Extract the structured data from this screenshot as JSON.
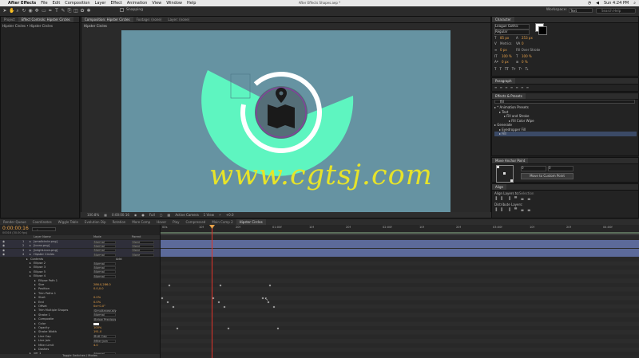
{
  "menubar": {
    "apple": "",
    "app": "After Effects",
    "items": [
      "File",
      "Edit",
      "Composition",
      "Layer",
      "Effect",
      "Animation",
      "View",
      "Window",
      "Help"
    ],
    "document_title": "After Effects Shapes.aep *",
    "clock": "Sun 4:24 PM"
  },
  "toolbar": {
    "snapping_label": "Snapping",
    "workspace_label": "Workspace:",
    "workspace_value": "Text",
    "search_placeholder": "Search Help"
  },
  "project": {
    "tabs": [
      "Project",
      "Effect Controls: Hipster Circles"
    ],
    "breadcrumb": "Hipster Circles • Hipster Circles"
  },
  "viewer": {
    "tabs": [
      "Composition: Hipster Circles",
      "Footage: (none)",
      "Layer: (none)"
    ],
    "comp_tab": "Hipster Circles",
    "zoom": "100.8%",
    "timecode": "0:00:00:16",
    "resolution": "Full",
    "camera": "Active Camera",
    "views": "1 View",
    "exposure": "+0.0"
  },
  "watermark": "www.cgtsj.com",
  "character": {
    "title": "Character",
    "font": "League Gothic",
    "style": "Regular",
    "size": "85 px",
    "leading": "253 px",
    "tracking": "Metrics",
    "kerning": "0",
    "stroke_width": "0 px",
    "stroke_mode": "Fill Over Stroke",
    "vscale": "100 %",
    "hscale": "100 %",
    "baseline": "0 px",
    "tsume": "0 %",
    "text_buttons": [
      "T",
      "T",
      "TT",
      "Tт",
      "T¹",
      "T₁"
    ]
  },
  "paragraph": {
    "title": "Paragraph"
  },
  "effects": {
    "title": "Effects & Presets",
    "search_value": "fill",
    "items": [
      {
        "label": "* Animation Presets",
        "indent": 0
      },
      {
        "label": "Text",
        "indent": 1
      },
      {
        "label": "Fill and Stroke",
        "indent": 2
      },
      {
        "label": "Fill Color Wipe",
        "indent": 3
      },
      {
        "label": "Generate",
        "indent": 0
      },
      {
        "label": "Eyedropper Fill",
        "indent": 1
      },
      {
        "label": "Fill",
        "indent": 1
      }
    ]
  },
  "anchor": {
    "title": "Move Anchor Point",
    "x": "0",
    "y": "0",
    "button": "Move to Custom Point"
  },
  "align": {
    "title": "Align",
    "align_to_label": "Align Layers to:",
    "align_to_value": "Selection",
    "distribute_label": "Distribute Layers:"
  },
  "timeline": {
    "tabs": [
      "Render Queue",
      "Coordinates",
      "Wiggle Table",
      "Evolution Dip",
      "Rotation",
      "More Comp",
      "Hover",
      "Play",
      "Compressed",
      "Main Comp 2",
      "Hipster Circles"
    ],
    "timecode": "0:00:00:16",
    "timecode_sub": "00016 (30.00 fps)",
    "col_layer_name": "Layer Name",
    "col_mode": "Mode",
    "col_parent": "Parent",
    "ruler": [
      "00s",
      "10f",
      "20f",
      "01:00f",
      "10f",
      "20f",
      "02:00f",
      "10f",
      "20f",
      "03:00f",
      "10f",
      "20f",
      "04:00f"
    ],
    "rows": [
      {
        "num": "1",
        "name": "[smallcircle.png]",
        "mode": "Normal",
        "parent": "None",
        "type": "layer"
      },
      {
        "num": "2",
        "name": "[icons.png]",
        "mode": "Normal",
        "parent": "None",
        "type": "layer"
      },
      {
        "num": "3",
        "name": "[bright-icon.png]",
        "mode": "Normal",
        "parent": "None",
        "type": "layer"
      },
      {
        "num": "4",
        "name": "Hipster Circles",
        "mode": "Normal",
        "parent": "None",
        "type": "layer"
      },
      {
        "name": "Contents",
        "type": "group",
        "extra": "Add:"
      },
      {
        "name": "Ellipse 2",
        "mode": "Normal",
        "type": "group"
      },
      {
        "name": "Ellipse 3",
        "mode": "Normal",
        "type": "group"
      },
      {
        "name": "Ellipse 5",
        "mode": "Normal",
        "type": "group"
      },
      {
        "name": "Ellipse 4",
        "mode": "Normal",
        "type": "group"
      },
      {
        "name": "Ellipse Path 1",
        "type": "prop"
      },
      {
        "name": "Size",
        "value": "286.0,286.0",
        "type": "prop"
      },
      {
        "name": "Position",
        "value": "0.0,0.0",
        "type": "prop"
      },
      {
        "name": "Trim Paths 1",
        "type": "prop"
      },
      {
        "name": "Start",
        "value": "0.0%",
        "type": "prop"
      },
      {
        "name": "End",
        "value": "0.0%",
        "type": "prop"
      },
      {
        "name": "Offset",
        "value": "0x+0.0°",
        "type": "prop"
      },
      {
        "name": "Trim Multiple Shapes",
        "mode": "Simultaneously",
        "type": "prop"
      },
      {
        "name": "Stroke 1",
        "mode": "Normal",
        "type": "prop"
      },
      {
        "name": "Composite",
        "mode": "Below Previous",
        "type": "prop"
      },
      {
        "name": "Color",
        "value": "",
        "type": "prop"
      },
      {
        "name": "Opacity",
        "value": "100%",
        "type": "prop"
      },
      {
        "name": "Stroke Width",
        "value": "191.0",
        "type": "prop"
      },
      {
        "name": "Line Cap",
        "mode": "Butt Cap",
        "type": "prop"
      },
      {
        "name": "Line Join",
        "mode": "Miter Join",
        "type": "prop"
      },
      {
        "name": "Miter Limit",
        "value": "4.0",
        "type": "prop"
      },
      {
        "name": "Dashes",
        "type": "prop"
      },
      {
        "name": "ver 1",
        "mode": "Normal",
        "type": "group"
      }
    ],
    "footer": "Toggle Switches / Modes"
  },
  "colors": {
    "canvas": "#6693a2",
    "mint": "#5ef5c0",
    "watermark": "#e6e32a",
    "dark_circle": "#556e78",
    "accent_circle": "#8a3aa0",
    "timecode": "#e8a24a"
  }
}
